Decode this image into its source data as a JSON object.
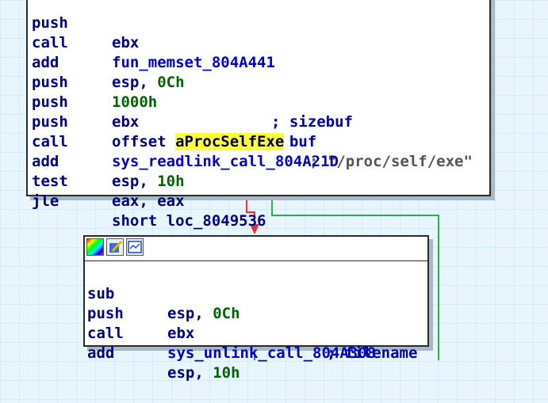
{
  "top_block": {
    "lines": [
      {
        "mnemonic": "push",
        "operand": "ebx",
        "comment": ""
      },
      {
        "mnemonic": "call",
        "operand": "fun_memset_804A441",
        "comment": ""
      },
      {
        "mnemonic": "add",
        "operand_reg": "esp, ",
        "operand_imm": "0Ch",
        "comment": ""
      },
      {
        "mnemonic": "push",
        "operand_imm": "1000h",
        "comment": "; sizebuf"
      },
      {
        "mnemonic": "push",
        "operand": "ebx",
        "comment": "; buf"
      },
      {
        "mnemonic": "push",
        "operand_prefix": "offset ",
        "operand_hl": "aProcSelfExe",
        "comment": "; \"/proc/self/exe\""
      },
      {
        "mnemonic": "call",
        "operand": "sys_readlink_call_804A21D",
        "comment": ""
      },
      {
        "mnemonic": "add",
        "operand_reg": "esp, ",
        "operand_imm": "10h",
        "comment": ""
      },
      {
        "mnemonic": "test",
        "operand_black": "eax, eax",
        "comment": ""
      },
      {
        "mnemonic": "jle",
        "operand_black": "short loc_8049536",
        "comment": ""
      }
    ]
  },
  "bottom_block": {
    "toolbar": [
      {
        "name": "node-color-icon"
      },
      {
        "name": "rename-node-icon"
      },
      {
        "name": "graph-overview-icon"
      }
    ],
    "lines": [
      {
        "mnemonic": "sub",
        "operand_reg": "esp, ",
        "operand_imm": "0Ch",
        "comment": ""
      },
      {
        "mnemonic": "push",
        "operand": "ebx",
        "comment": "; filename"
      },
      {
        "mnemonic": "call",
        "operand": "sys_unlink_call_804A308",
        "comment": ""
      },
      {
        "mnemonic": "add",
        "operand_reg": "esp, ",
        "operand_imm": "10h",
        "comment": ""
      }
    ]
  },
  "colors": {
    "background": "#e9f5fd",
    "edge_false": "#e8322e",
    "edge_true": "#33a852",
    "edge_normal": "#3b6fd8",
    "highlight": "#ffff3a"
  }
}
